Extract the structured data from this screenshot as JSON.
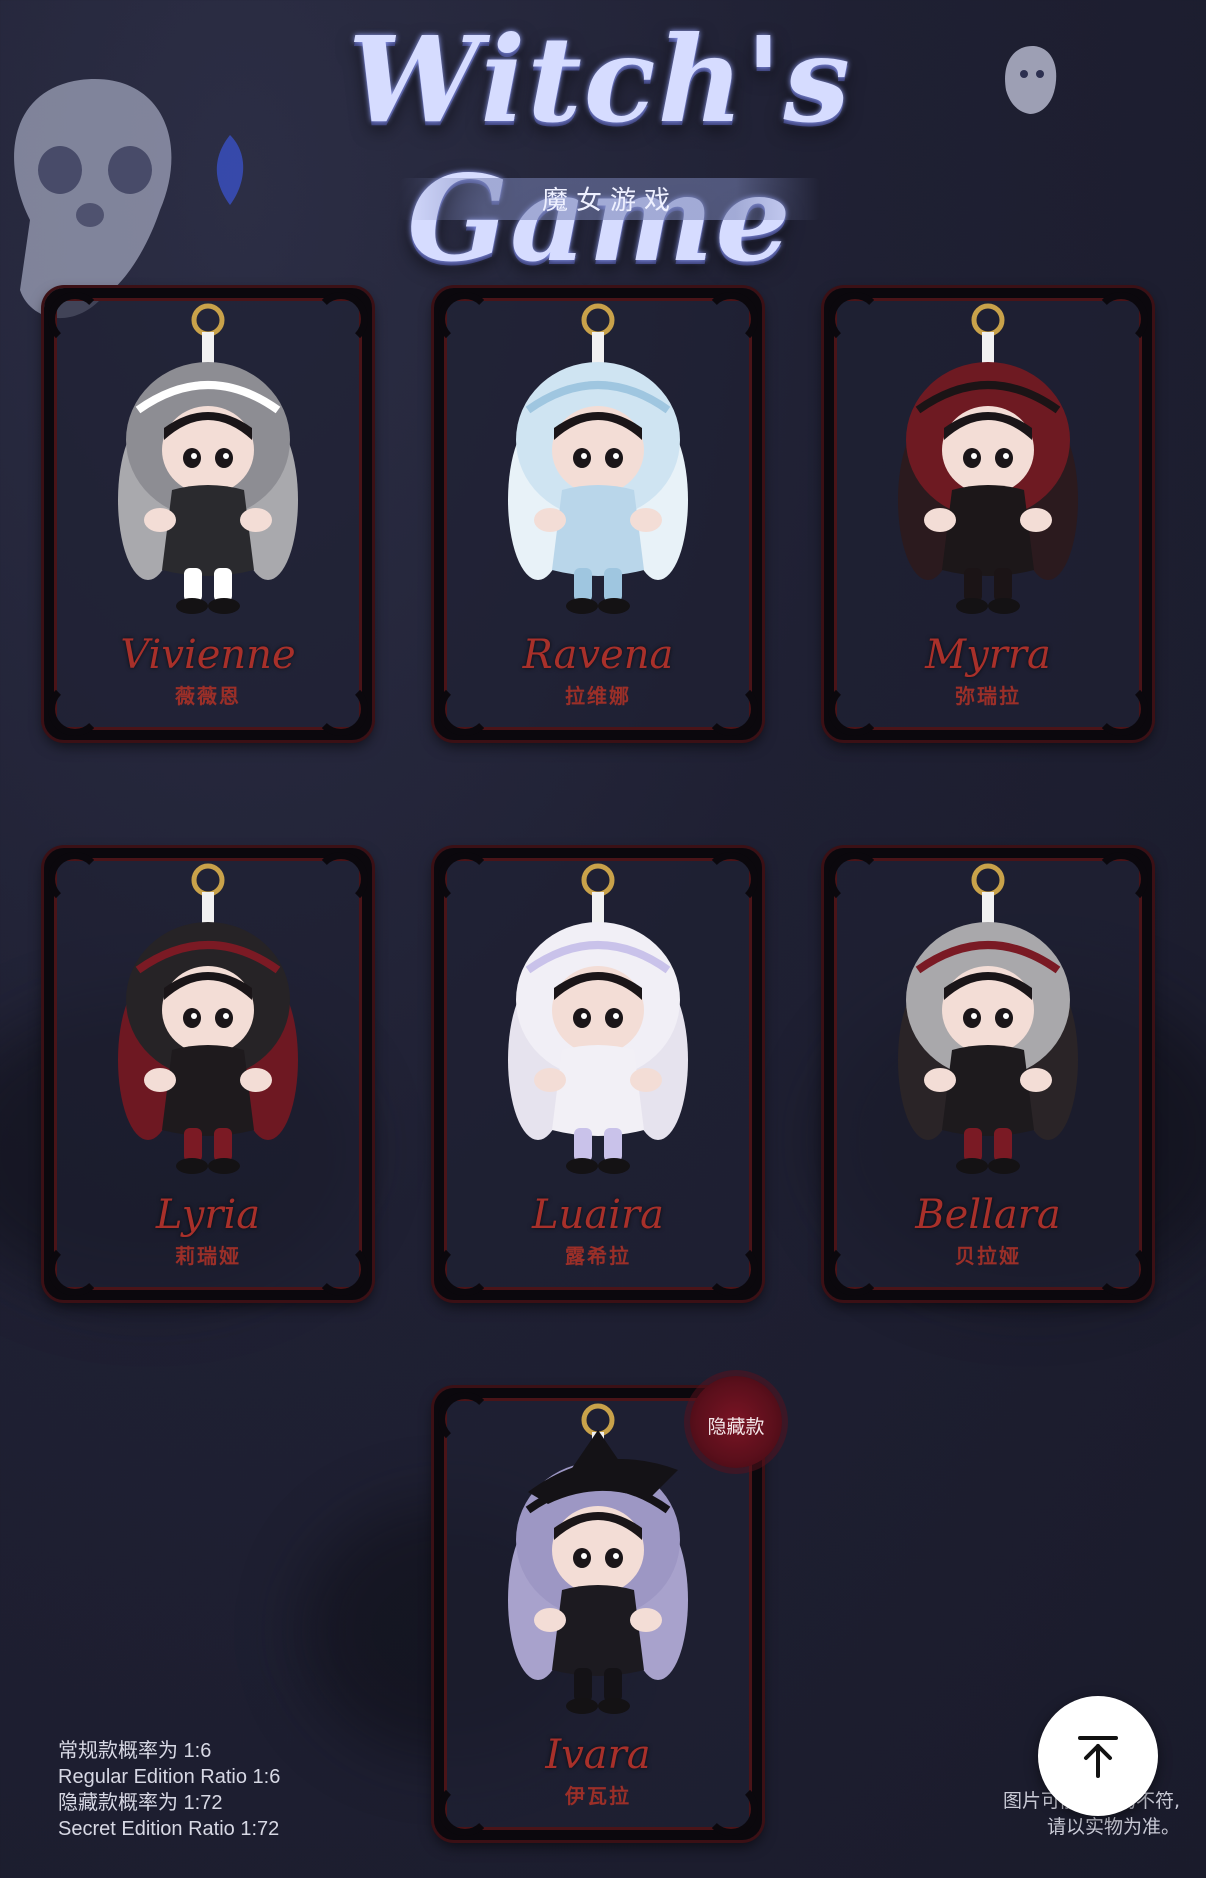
{
  "header": {
    "title": "Witch's Game",
    "subtitle": "魔女游戏"
  },
  "characters": [
    {
      "name": "Vivienne",
      "cn": "薇薇恩",
      "hood": "#8d8d93",
      "accent": "#ffffff",
      "dress": "#2a2a2e",
      "ears": "#a9a9ad"
    },
    {
      "name": "Ravena",
      "cn": "拉维娜",
      "hood": "#cfe4f2",
      "accent": "#9fc6e0",
      "dress": "#b9d6ea",
      "ears": "#e8f2f8"
    },
    {
      "name": "Myrra",
      "cn": "弥瑞拉",
      "hood": "#6e1a22",
      "accent": "#1b1416",
      "dress": "#1c1719",
      "ears": "#2b1a1e"
    },
    {
      "name": "Lyria",
      "cn": "莉瑞娅",
      "hood": "#262326",
      "accent": "#7b1a24",
      "dress": "#1e1a1d",
      "ears": "#6e1822"
    },
    {
      "name": "Luaira",
      "cn": "露希拉",
      "hood": "#f1eff6",
      "accent": "#c9c2ea",
      "dress": "#f2f0f6",
      "ears": "#e6e3ee"
    },
    {
      "name": "Bellara",
      "cn": "贝拉娅",
      "hood": "#a9a8ab",
      "accent": "#7a1a24",
      "dress": "#1d1a1d",
      "ears": "#2a2427"
    },
    {
      "name": "Ivara",
      "cn": "伊瓦拉",
      "hood": "#9d97c4",
      "accent": "#141216",
      "dress": "#1c1a20",
      "ears": "#a8a2cc"
    }
  ],
  "secret_badge": "隐藏款",
  "ratios": {
    "line1": "常规款概率为 1:6",
    "line2": "Regular Edition Ratio 1:6",
    "line3": "隐藏款概率为 1:72",
    "line4": "Secret Edition Ratio 1:72"
  },
  "disclaimer": {
    "line1": "图片可能与实物不符,",
    "line2": "请以实物为准。"
  },
  "back_to_top_icon": "arrow-up-to-line-icon"
}
